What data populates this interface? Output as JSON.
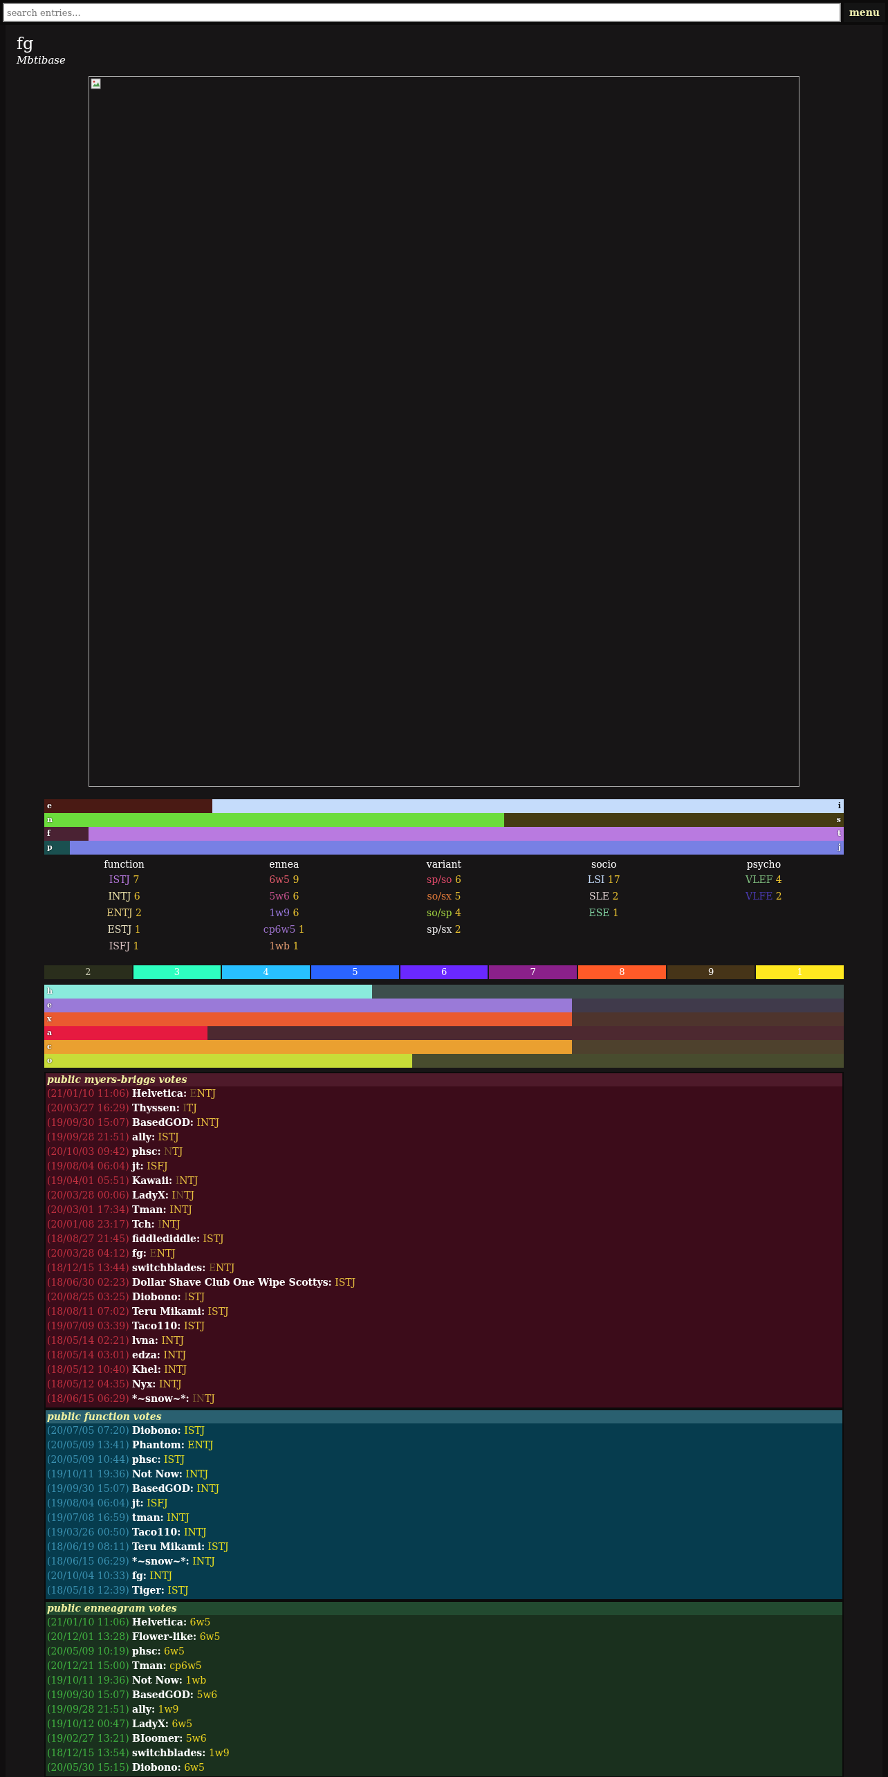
{
  "search": {
    "placeholder": "search entries..."
  },
  "menu_button": "menu",
  "profile": {
    "name": "fg",
    "site": "Mbtibase"
  },
  "dichotomies": [
    {
      "level": 0.21,
      "left": {
        "label": "e",
        "color": "#4a1a14"
      },
      "right": {
        "label": "i",
        "color": "#c5dcfb"
      }
    },
    {
      "level": 0.575,
      "left": {
        "label": "n",
        "color": "#6cdc3c"
      },
      "right": {
        "label": "s",
        "color": "#453c12"
      }
    },
    {
      "level": 0.055,
      "left": {
        "label": "f",
        "color": "#4a2233"
      },
      "right": {
        "label": "t",
        "color": "#b97ae0"
      }
    },
    {
      "level": 0.032,
      "left": {
        "label": "p",
        "color": "#1a5050"
      },
      "right": {
        "label": "j",
        "color": "#7880e4"
      }
    }
  ],
  "stats": [
    {
      "heading": "function",
      "entries": [
        {
          "label": "ISTJ",
          "count": "7",
          "color": "#b97ae0"
        },
        {
          "label": "INTJ",
          "count": "6",
          "color": "#e8e0a8"
        },
        {
          "label": "ENTJ",
          "count": "2",
          "color": "#e8d080"
        },
        {
          "label": "ESTJ",
          "count": "1",
          "color": "#e8e0c0"
        },
        {
          "label": "ISFJ",
          "count": "1",
          "color": "#d8c0c0"
        }
      ]
    },
    {
      "heading": "ennea",
      "entries": [
        {
          "label": "6w5",
          "count": "9",
          "color": "#e05a6a"
        },
        {
          "label": "5w6",
          "count": "6",
          "color": "#c0508a"
        },
        {
          "label": "1w9",
          "count": "6",
          "color": "#9a7ae0"
        },
        {
          "label": "cp6w5",
          "count": "1",
          "color": "#9a70c8"
        },
        {
          "label": "1wb",
          "count": "1",
          "color": "#e09a70"
        }
      ]
    },
    {
      "heading": "variant",
      "entries": [
        {
          "label": "sp/so",
          "count": "6",
          "color": "#e04a6a"
        },
        {
          "label": "so/sx",
          "count": "5",
          "color": "#e07a3a"
        },
        {
          "label": "so/sp",
          "count": "4",
          "color": "#a0d040"
        },
        {
          "label": "sp/sx",
          "count": "2",
          "color": "#e8e8e8"
        }
      ]
    },
    {
      "heading": "socio",
      "entries": [
        {
          "label": "LSI",
          "count": "17",
          "color": "#c5dcfb"
        },
        {
          "label": "SLE",
          "count": "2",
          "color": "#e0d0d0"
        },
        {
          "label": "ESE",
          "count": "1",
          "color": "#80d0a0"
        }
      ]
    },
    {
      "heading": "psycho",
      "entries": [
        {
          "label": "VLEF",
          "count": "4",
          "color": "#80c080"
        },
        {
          "label": "VLFE",
          "count": "2",
          "color": "#4a3ab0"
        }
      ]
    }
  ],
  "ennea_types": [
    {
      "label": "2",
      "color": "#2a2e1c"
    },
    {
      "label": "3",
      "color": "#2effc0"
    },
    {
      "label": "4",
      "color": "#28c0ff"
    },
    {
      "label": "5",
      "color": "#2a64ff"
    },
    {
      "label": "6",
      "color": "#6a28ff"
    },
    {
      "label": "7",
      "color": "#8a208a"
    },
    {
      "label": "8",
      "color": "#ff5a28"
    },
    {
      "label": "9",
      "color": "#463418"
    },
    {
      "label": "1",
      "color": "#ffe820"
    }
  ],
  "hexaco": [
    {
      "label": "h",
      "level": 0.41,
      "color": "#8aeadc"
    },
    {
      "label": "e",
      "level": 0.66,
      "color": "#9a7ad8"
    },
    {
      "label": "x",
      "level": 0.66,
      "color": "#ea5a30"
    },
    {
      "label": "a",
      "level": 0.204,
      "color": "#e61a40"
    },
    {
      "label": "c",
      "level": 0.66,
      "color": "#eaa030"
    },
    {
      "label": "o",
      "level": 0.46,
      "color": "#c8dc38"
    }
  ],
  "vote_sections": [
    {
      "kind": "myers-briggs",
      "title": "public myers-briggs votes",
      "votes": [
        {
          "date": "(21/01/10 11:06)",
          "name": "Helvetica:",
          "vote": [
            {
              "text": "E",
              "faint": true
            },
            {
              "text": "NTJ",
              "faint": false
            }
          ]
        },
        {
          "date": "(20/03/27 16:29)",
          "name": "Thyssen:",
          "vote": [
            {
              "text": "I",
              "faint": true
            },
            {
              "text": "TJ",
              "faint": false
            }
          ]
        },
        {
          "date": "(19/09/30 15:07)",
          "name": "BasedGOD:",
          "vote": [
            {
              "text": "INTJ",
              "faint": false
            }
          ]
        },
        {
          "date": "(19/09/28 21:51)",
          "name": "ally:",
          "vote": [
            {
              "text": "ISTJ",
              "faint": false
            }
          ]
        },
        {
          "date": "(20/10/03 09:42)",
          "name": "phsc:",
          "vote": [
            {
              "text": "N",
              "faint": true
            },
            {
              "text": "TJ",
              "faint": false
            }
          ]
        },
        {
          "date": "(19/08/04 06:04)",
          "name": "jt:",
          "vote": [
            {
              "text": "ISFJ",
              "faint": false
            }
          ]
        },
        {
          "date": "(19/04/01 05:51)",
          "name": "Kawaii:",
          "vote": [
            {
              "text": "I",
              "faint": true
            },
            {
              "text": "NTJ",
              "faint": false
            }
          ]
        },
        {
          "date": "(20/03/28 00:06)",
          "name": "LadyX:",
          "vote": [
            {
              "text": "I",
              "faint": false
            },
            {
              "text": "N",
              "faint": true
            },
            {
              "text": "TJ",
              "faint": false
            }
          ]
        },
        {
          "date": "(20/03/01 17:34)",
          "name": "Tman:",
          "vote": [
            {
              "text": "INTJ",
              "faint": false
            }
          ]
        },
        {
          "date": "(20/01/08 23:17)",
          "name": "Tch:",
          "vote": [
            {
              "text": "I",
              "faint": true
            },
            {
              "text": "NTJ",
              "faint": false
            }
          ]
        },
        {
          "date": "(18/08/27 21:45)",
          "name": "fiddlediddle:",
          "vote": [
            {
              "text": "ISTJ",
              "faint": false
            }
          ]
        },
        {
          "date": "(20/03/28 04:12)",
          "name": "fg:",
          "vote": [
            {
              "text": "E",
              "faint": true
            },
            {
              "text": "NTJ",
              "faint": false
            }
          ]
        },
        {
          "date": "(18/12/15 13:44)",
          "name": "switchblades:",
          "vote": [
            {
              "text": "E",
              "faint": true
            },
            {
              "text": "NTJ",
              "faint": false
            }
          ]
        },
        {
          "date": "(18/06/30 02:23)",
          "name": "Dollar Shave Club One Wipe Scottys:",
          "vote": [
            {
              "text": "ISTJ",
              "faint": false
            }
          ]
        },
        {
          "date": "(20/08/25 03:25)",
          "name": "Diobono:",
          "vote": [
            {
              "text": "I",
              "faint": true
            },
            {
              "text": "STJ",
              "faint": false
            }
          ]
        },
        {
          "date": "(18/08/11 07:02)",
          "name": "Teru Mikami:",
          "vote": [
            {
              "text": "ISTJ",
              "faint": false
            }
          ]
        },
        {
          "date": "(19/07/09 03:39)",
          "name": "Taco110:",
          "vote": [
            {
              "text": "ISTJ",
              "faint": false
            }
          ]
        },
        {
          "date": "(18/05/14 02:21)",
          "name": "lvna:",
          "vote": [
            {
              "text": "INTJ",
              "faint": false
            }
          ]
        },
        {
          "date": "(18/05/14 03:01)",
          "name": "edza:",
          "vote": [
            {
              "text": "INTJ",
              "faint": false
            }
          ]
        },
        {
          "date": "(18/05/12 10:40)",
          "name": "Khel:",
          "vote": [
            {
              "text": "INTJ",
              "faint": false
            }
          ]
        },
        {
          "date": "(18/05/12 04:35)",
          "name": "Nyx:",
          "vote": [
            {
              "text": "INTJ",
              "faint": false
            }
          ]
        },
        {
          "date": "(18/06/15 06:29)",
          "name": "*~snow~*:",
          "vote": [
            {
              "text": "IN",
              "faint": true
            },
            {
              "text": "TJ",
              "faint": false
            }
          ]
        }
      ]
    },
    {
      "kind": "function",
      "title": "public function votes",
      "votes": [
        {
          "date": "(20/07/05 07:20)",
          "name": "Diobono:",
          "vote": "ISTJ"
        },
        {
          "date": "(20/05/09 13:41)",
          "name": "Phantom:",
          "vote": "ENTJ"
        },
        {
          "date": "(20/05/09 10:44)",
          "name": "phsc:",
          "vote": "ISTJ"
        },
        {
          "date": "(19/10/11 19:36)",
          "name": "Not Now:",
          "vote": "INTJ"
        },
        {
          "date": "(19/09/30 15:07)",
          "name": "BasedGOD:",
          "vote": "INTJ"
        },
        {
          "date": "(19/08/04 06:04)",
          "name": "jt:",
          "vote": "ISFJ"
        },
        {
          "date": "(19/07/08 16:59)",
          "name": "tman:",
          "vote": "INTJ"
        },
        {
          "date": "(19/03/26 00:50)",
          "name": "Taco110:",
          "vote": "INTJ"
        },
        {
          "date": "(18/06/19 08:11)",
          "name": "Teru Mikami:",
          "vote": "ISTJ"
        },
        {
          "date": "(18/06/15 06:29)",
          "name": "*~snow~*:",
          "vote": "INTJ"
        },
        {
          "date": "(20/10/04 10:33)",
          "name": "fg:",
          "vote": "INTJ"
        },
        {
          "date": "(18/05/18 12:39)",
          "name": "Tiger:",
          "vote": "ISTJ"
        }
      ]
    },
    {
      "kind": "enneagram",
      "title": "public enneagram votes",
      "votes": [
        {
          "date": "(21/01/10 11:06)",
          "name": "Helvetica:",
          "vote": "6w5"
        },
        {
          "date": "(20/12/01 13:28)",
          "name": "Flower-like:",
          "vote": "6w5"
        },
        {
          "date": "(20/05/09 10:19)",
          "name": "phsc:",
          "vote": "6w5"
        },
        {
          "date": "(20/12/21 15:00)",
          "name": "Tman:",
          "vote": "cp6w5"
        },
        {
          "date": "(19/10/11 19:36)",
          "name": "Not Now:",
          "vote": "1wb"
        },
        {
          "date": "(19/09/30 15:07)",
          "name": "BasedGOD:",
          "vote": "5w6"
        },
        {
          "date": "(19/09/28 21:51)",
          "name": "ally:",
          "vote": "1w9"
        },
        {
          "date": "(19/10/12 00:47)",
          "name": "LadyX:",
          "vote": "6w5"
        },
        {
          "date": "(19/02/27 13:21)",
          "name": "BIoomer:",
          "vote": "5w6"
        },
        {
          "date": "(18/12/15 13:54)",
          "name": "switchblades:",
          "vote": "1w9"
        },
        {
          "date": "(20/05/30 15:15)",
          "name": "Diobono:",
          "vote": "6w5"
        }
      ]
    }
  ]
}
